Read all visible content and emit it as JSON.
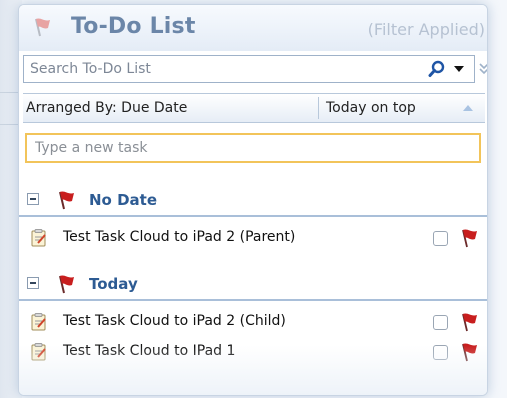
{
  "header": {
    "title": "To-Do List",
    "filter_status": "(Filter Applied)"
  },
  "search": {
    "placeholder": "Search To-Do List"
  },
  "arrange": {
    "label": "Arranged By: Due Date",
    "order": "Today on top"
  },
  "new_task": {
    "placeholder": "Type a new task"
  },
  "groups": [
    {
      "label": "No Date",
      "tasks": [
        {
          "title": "Test Task Cloud to iPad 2 (Parent)",
          "completed": false
        }
      ]
    },
    {
      "label": "Today",
      "tasks": [
        {
          "title": "Test Task Cloud to iPad 2 (Child)",
          "completed": false
        },
        {
          "title": "Test Task Cloud to IPad 1",
          "completed": false
        }
      ]
    }
  ],
  "colors": {
    "title_text": "#6b86a8",
    "group_text": "#2d5b93",
    "flag_red": "#c81e1e",
    "new_task_border": "#f2c45a"
  },
  "icons": {
    "header": "flag-icon",
    "search": "search-icon",
    "search_dropdown": "dropdown-arrow-icon",
    "pane_collapse": "double-chevron-down-icon",
    "sort": "sort-ascending-icon",
    "group_collapse": "collapse-minus-icon",
    "task": "task-clipboard-icon",
    "task_flag": "red-flag-icon"
  }
}
